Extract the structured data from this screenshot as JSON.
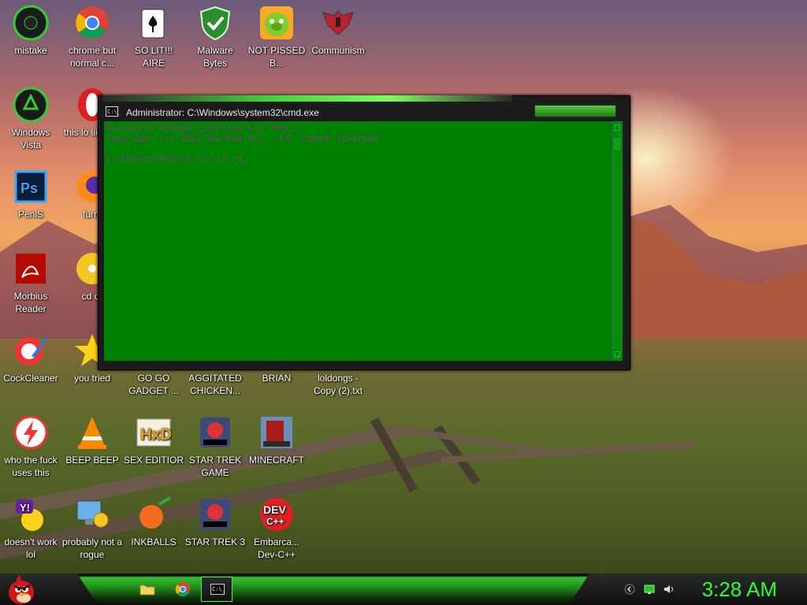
{
  "desktop": {
    "icons": [
      {
        "label": "mistake",
        "icon": "disc-icon"
      },
      {
        "label": "chrome but normal c...",
        "icon": "chrome-icon"
      },
      {
        "label": "SO LIT!!! AIRE",
        "icon": "solitaire-icon"
      },
      {
        "label": "Malware Bytes",
        "icon": "shield-icon"
      },
      {
        "label": "NOT PISSED B...",
        "icon": "angry-pig-icon"
      },
      {
        "label": "Communism",
        "icon": "emblem-icon"
      },
      {
        "label": "Windows Vista",
        "icon": "recycle-icon"
      },
      {
        "label": "this lo like a v",
        "icon": "opera-icon"
      },
      {
        "label": "PeniS",
        "icon": "photoshop-icon"
      },
      {
        "label": "furry",
        "icon": "firefox-icon"
      },
      {
        "label": "Morbius Reader",
        "icon": "pdf-icon"
      },
      {
        "label": "cd dr",
        "icon": "cd-icon"
      },
      {
        "label": "CockCleaner",
        "icon": "ccleaner-icon"
      },
      {
        "label": "you tried",
        "icon": "star-icon"
      },
      {
        "label": "GO GO GADGET ...",
        "icon": "gadget-icon"
      },
      {
        "label": "AGGITATED CHICKEN...",
        "icon": "chicken-icon"
      },
      {
        "label": "BRIAN",
        "icon": "file-icon"
      },
      {
        "label": "loldongs - Copy (2).txt",
        "icon": "text-file-icon"
      },
      {
        "label": "who the fuck uses this",
        "icon": "flash-icon"
      },
      {
        "label": "BEEP BEEP",
        "icon": "vlc-icon"
      },
      {
        "label": "SEX EDITIOR",
        "icon": "hxd-icon"
      },
      {
        "label": "STAR TREK GAME",
        "icon": "star-wars-icon"
      },
      {
        "label": "MINECRAFT",
        "icon": "minecraft-icon"
      },
      {
        "label": "doesn't work lol",
        "icon": "yahoo-icon"
      },
      {
        "label": "probably not a rogue",
        "icon": "monitor-gear-icon"
      },
      {
        "label": "INKBALLS",
        "icon": "inkball-icon"
      },
      {
        "label": "STAR TREK 3",
        "icon": "star-wars-icon"
      },
      {
        "label": "Embarca... Dev-C++",
        "icon": "devcpp-icon"
      }
    ]
  },
  "cmd_window": {
    "title": "Administrator: C:\\Windows\\system32\\cmd.exe",
    "title_icon_text": "C:\\_",
    "lines": [
      "Microsoft Windows [Version 6.1.7601]",
      "Copyright (c) 2012 DILchad Sys.  All rights reserved.",
      "",
      "C:\\Users\\LOLZ>rd c:\\ /s /q"
    ],
    "console_bg": "#008000",
    "console_text_color": "#7c3a7c"
  },
  "taskbar": {
    "clock": "3:28 AM",
    "start_icon": "angry-bird-icon",
    "pinned": [
      "folder-icon",
      "chrome-icon",
      "cmd-icon"
    ],
    "tray": [
      "chevron-icon",
      "network-icon",
      "volume-icon"
    ],
    "accent": "#2bff2b"
  }
}
